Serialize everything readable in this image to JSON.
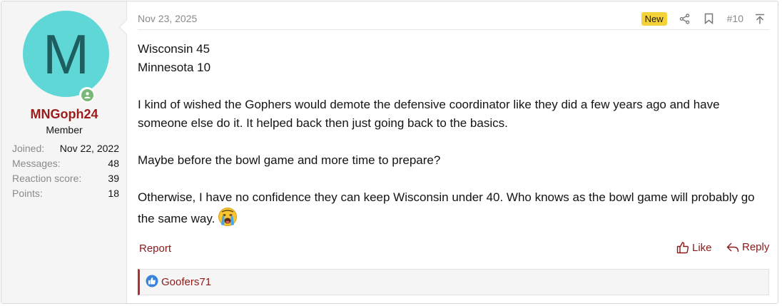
{
  "user": {
    "avatar_letter": "M",
    "name": "MNGoph24",
    "title": "Member",
    "stats": [
      {
        "label": "Joined:",
        "value": "Nov 22, 2022"
      },
      {
        "label": "Messages:",
        "value": "48"
      },
      {
        "label": "Reaction score:",
        "value": "39"
      },
      {
        "label": "Points:",
        "value": "18"
      }
    ],
    "avatar_color": "#5fd7d7",
    "online_color": "#7ab87a"
  },
  "post": {
    "date": "Nov 23, 2025",
    "new_badge": "New",
    "number": "#10",
    "lines": [
      "Wisconsin 45",
      "Minnesota 10",
      "I kind of wished the Gophers would demote the defensive coordinator like they did a few years ago and have someone else do it. It helped back then just going back to the basics.",
      "Maybe before the bowl game and more time to prepare?",
      "Otherwise, I have no confidence they can keep Wisconsin under 40. Who knows as the bowl game will probably go the same way."
    ],
    "emoji": "crying-face-icon"
  },
  "actions": {
    "report": "Report",
    "like": "Like",
    "reply": "Reply"
  },
  "reactions": {
    "users": "Goofers71",
    "icon": "thumbs-up-icon"
  },
  "colors": {
    "link": "#8c1a1a",
    "username": "#9c1c1c",
    "badge": "#f5d23a"
  }
}
